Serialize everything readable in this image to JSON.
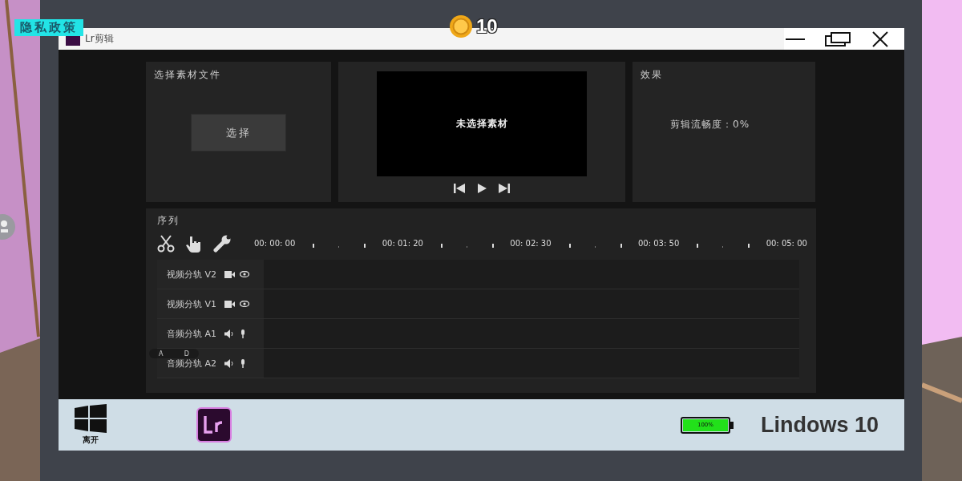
{
  "hud": {
    "privacy_button": "隐私政策",
    "coins": "10"
  },
  "window": {
    "title": "Lr剪辑"
  },
  "source_panel": {
    "title": "选择素材文件",
    "button": "选择"
  },
  "preview": {
    "message": "未选择素材"
  },
  "effects_panel": {
    "title": "效果",
    "smoothness": "剪辑流畅度：0%"
  },
  "sequence": {
    "title": "序列",
    "timecodes": [
      "00: 00: 00",
      "00: 01: 20",
      "00: 02: 30",
      "00: 03: 50",
      "00: 05: 00"
    ],
    "tracks": [
      {
        "label": "视频分轨 V2",
        "kind": "video"
      },
      {
        "label": "视频分轨 V1",
        "kind": "video"
      },
      {
        "label": "音频分轨 A1",
        "kind": "audio"
      },
      {
        "label": "音频分轨 A2",
        "kind": "audio"
      }
    ]
  },
  "joystick": {
    "left": "A",
    "right": "D"
  },
  "taskbar": {
    "start_label": "离开",
    "battery": {
      "level": 1,
      "reading": "100%"
    },
    "os_name": "Lindows 10"
  }
}
